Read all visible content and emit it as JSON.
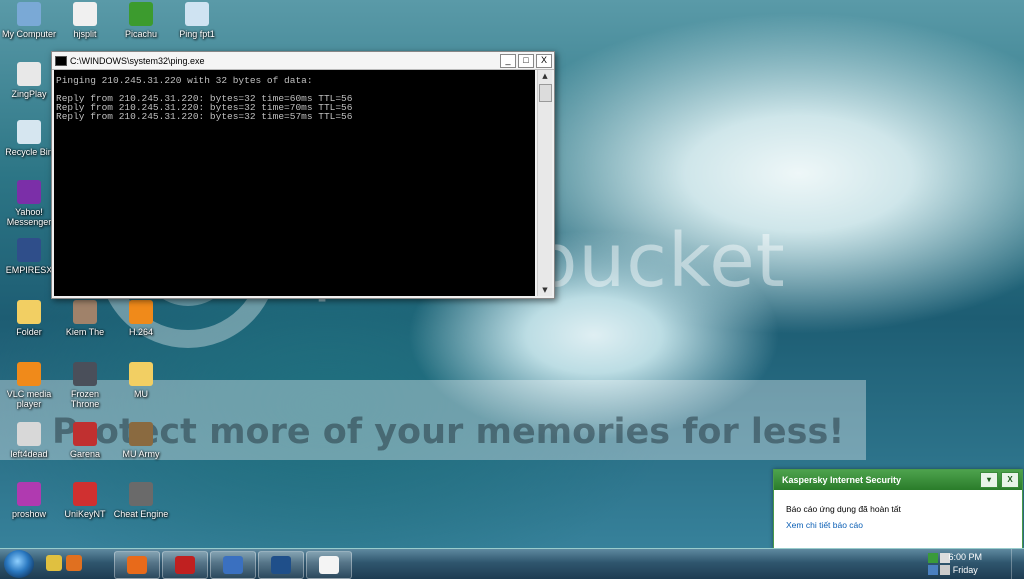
{
  "watermark": {
    "brand": "photobucket",
    "promo": "Protect more of your memories for less!"
  },
  "desktop_icons": [
    {
      "id": "my-computer",
      "label": "My Computer",
      "icon": "computer-icon",
      "color": "#7aa9d6"
    },
    {
      "id": "hjsplit",
      "label": "hjsplit",
      "icon": "checkmark-icon",
      "color": "#f0f0f0"
    },
    {
      "id": "picachu",
      "label": "Picachu",
      "icon": "game-icon",
      "color": "#3c9b2e"
    },
    {
      "id": "ping-fpt1",
      "label": "Ping fpt1",
      "icon": "shortcut-icon",
      "color": "#cfe3f2"
    },
    {
      "id": "zingplay",
      "label": "ZingPlay",
      "icon": "spade-icon",
      "color": "#e8e8e8"
    },
    {
      "id": "recycle-bin",
      "label": "Recycle Bin",
      "icon": "recycle-bin-icon",
      "color": "#d6e6f0"
    },
    {
      "id": "yahoo-messenger",
      "label": "Yahoo! Messenger",
      "icon": "yahoo-smiley-icon",
      "color": "#7b2fa8"
    },
    {
      "id": "empiresx",
      "label": "EMPIRESX",
      "icon": "game-icon",
      "color": "#2f4e8a"
    },
    {
      "id": "folder",
      "label": "Folder",
      "icon": "folder-icon",
      "color": "#f2cf63"
    },
    {
      "id": "kiem-the",
      "label": "Kiem The",
      "icon": "game-icon",
      "color": "#a0826a"
    },
    {
      "id": "h264",
      "label": "H.264",
      "icon": "vlc-cone-icon",
      "color": "#f08a1a"
    },
    {
      "id": "vlc",
      "label": "VLC media player",
      "icon": "vlc-cone-icon",
      "color": "#f08a1a"
    },
    {
      "id": "frozen-throne",
      "label": "Frozen Throne",
      "icon": "game-icon",
      "color": "#4a4f5a"
    },
    {
      "id": "mu",
      "label": "MU",
      "icon": "folder-icon",
      "color": "#f2cf63"
    },
    {
      "id": "left4dead",
      "label": "left4dead",
      "icon": "game-icon",
      "color": "#d8d8d8"
    },
    {
      "id": "garena",
      "label": "Garena",
      "icon": "game-icon",
      "color": "#c03030"
    },
    {
      "id": "mu-army",
      "label": "MU Army",
      "icon": "game-icon",
      "color": "#8a6a40"
    },
    {
      "id": "proshow",
      "label": "proshow",
      "icon": "proshow-icon",
      "color": "#b03ab0"
    },
    {
      "id": "unikeynt",
      "label": "UniKeyNT",
      "icon": "keyboard-icon",
      "color": "#d03030"
    },
    {
      "id": "cheat-engine",
      "label": "Cheat Engine",
      "icon": "gear-icon",
      "color": "#6a6a6a"
    }
  ],
  "console": {
    "title": "C:\\WINDOWS\\system32\\ping.exe",
    "output": "Pinging 210.245.31.220 with 32 bytes of data:\n\nReply from 210.245.31.220: bytes=32 time=60ms TTL=56\nReply from 210.245.31.220: bytes=32 time=70ms TTL=56\nReply from 210.245.31.220: bytes=32 time=57ms TTL=56",
    "minimize": "_",
    "maximize": "□",
    "close": "X"
  },
  "taskbar": {
    "quick_launch": [
      {
        "name": "chrome-icon",
        "color": "#e0c040"
      },
      {
        "name": "firefox-icon",
        "color": "#e07020"
      }
    ],
    "buttons": [
      {
        "name": "firefox-task",
        "color": "#e86a1a"
      },
      {
        "name": "red-app-task",
        "color": "#c02020"
      },
      {
        "name": "console-task",
        "color": "#3a70c0"
      },
      {
        "name": "photoshop-task",
        "color": "#1f4f8a"
      },
      {
        "name": "blank-document-task",
        "color": "#f4f4f4"
      }
    ],
    "clock_time": "6:00 PM",
    "clock_day": "Friday"
  },
  "kaspersky": {
    "title": "Kaspersky Internet Security",
    "message": "Báo cáo ứng dụng đã hoàn tất",
    "link": "Xem chi tiết báo cáo",
    "menu_btn": "▾",
    "close_btn": "X"
  }
}
